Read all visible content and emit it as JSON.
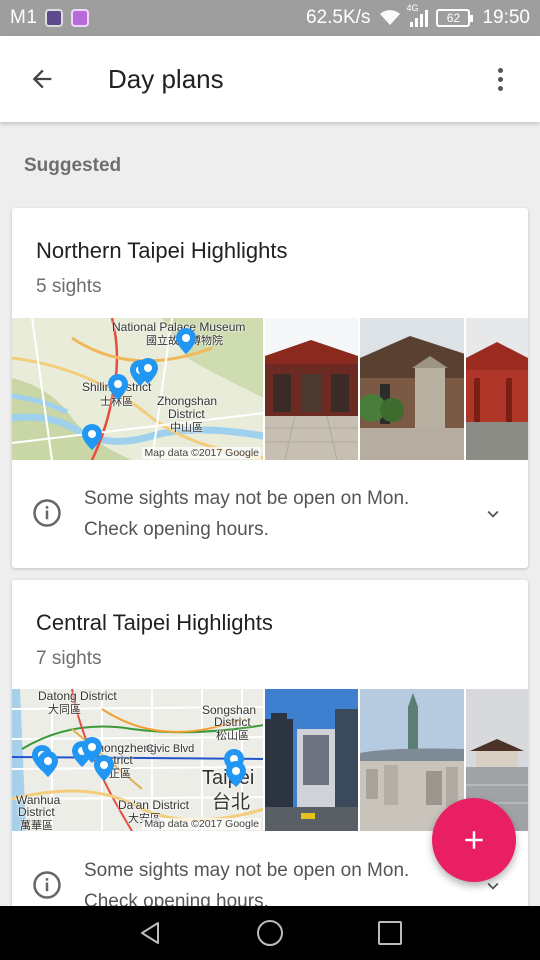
{
  "status_bar": {
    "carrier": "M1",
    "network_speed": "62.5K/s",
    "network_type": "4G",
    "battery": "62",
    "time": "19:50"
  },
  "app_bar": {
    "title": "Day plans"
  },
  "section_label": "Suggested",
  "cards": [
    {
      "title": "Northern Taipei Highlights",
      "subtitle": "5 sights",
      "map_labels": [
        "National Palace Museum",
        "國立故宮博物院",
        "Shilin District",
        "士林區",
        "Zhongshan",
        "District",
        "中山區"
      ],
      "map_credit": "Map data ©2017 Google",
      "notice": [
        "Some sights may not be open on Mon.",
        "Check opening hours."
      ]
    },
    {
      "title": "Central Taipei Highlights",
      "subtitle": "7 sights",
      "map_labels": [
        "Datong District",
        "大同區",
        "Songshan",
        "District",
        "松山區",
        "Zhongzheng",
        "District",
        "中正區",
        "Civic Blvd",
        "Taipei",
        "台北",
        "Wanhua",
        "District",
        "萬華區",
        "Da'an District",
        "大安區"
      ],
      "map_credit": "Map data ©2017 Google",
      "notice": [
        "Some sights may not be open on Mon.",
        "Check opening hours."
      ]
    }
  ],
  "icons": {
    "back": "arrow-back-icon",
    "more": "more-vert-icon",
    "info": "info-outline-icon",
    "expand": "chevron-down-icon",
    "add": "plus-icon",
    "nav_back": "triangle-back-icon",
    "nav_home": "circle-home-icon",
    "nav_recents": "square-recents-icon"
  },
  "colors": {
    "accent": "#e91e63",
    "map_pin": "#2196f3",
    "status_bar": "#9e9e9e"
  }
}
